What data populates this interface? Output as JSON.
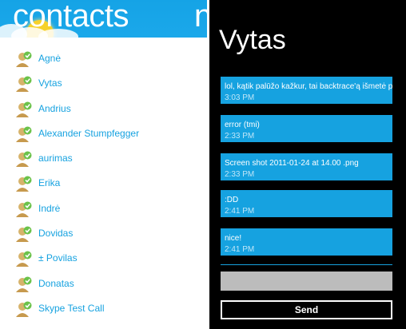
{
  "contacts_panel": {
    "title": "contacts",
    "next_pivot_partial": "n",
    "contacts": [
      {
        "name": "Agnė"
      },
      {
        "name": "Vytas"
      },
      {
        "name": "Andrius"
      },
      {
        "name": "Alexander Stumpfegger"
      },
      {
        "name": "aurimas"
      },
      {
        "name": "Erika"
      },
      {
        "name": "Indrė"
      },
      {
        "name": "Dovidas"
      },
      {
        "name": "± Povilas"
      },
      {
        "name": "Donatas"
      },
      {
        "name": "Skype Test Call"
      }
    ]
  },
  "chat_panel": {
    "title": "Vytas",
    "messages": [
      {
        "text": "lol, kątik palūžo kažkur, tai backtrace'ą išmetė p",
        "time": "3:03 PM"
      },
      {
        "text": "error (tmi)",
        "time": "2:33 PM"
      },
      {
        "text": "Screen shot 2011-01-24 at 14.00 .png",
        "time": "2:33 PM"
      },
      {
        "text": ":DD",
        "time": "2:41 PM"
      },
      {
        "text": "nice!",
        "time": "2:41 PM"
      }
    ],
    "input": {
      "value": "",
      "placeholder": ""
    },
    "send_label": "Send"
  },
  "colors": {
    "accent": "#16a2e0",
    "header_blue": "#1ba8ea",
    "chat_background": "#000000",
    "input_gray": "#bcbcbc",
    "status_green": "#6cc24a"
  },
  "icons": {
    "contact_avatar": "contact-online-avatar-icon",
    "header_decoration": "weather-cloud-sun-icon"
  }
}
